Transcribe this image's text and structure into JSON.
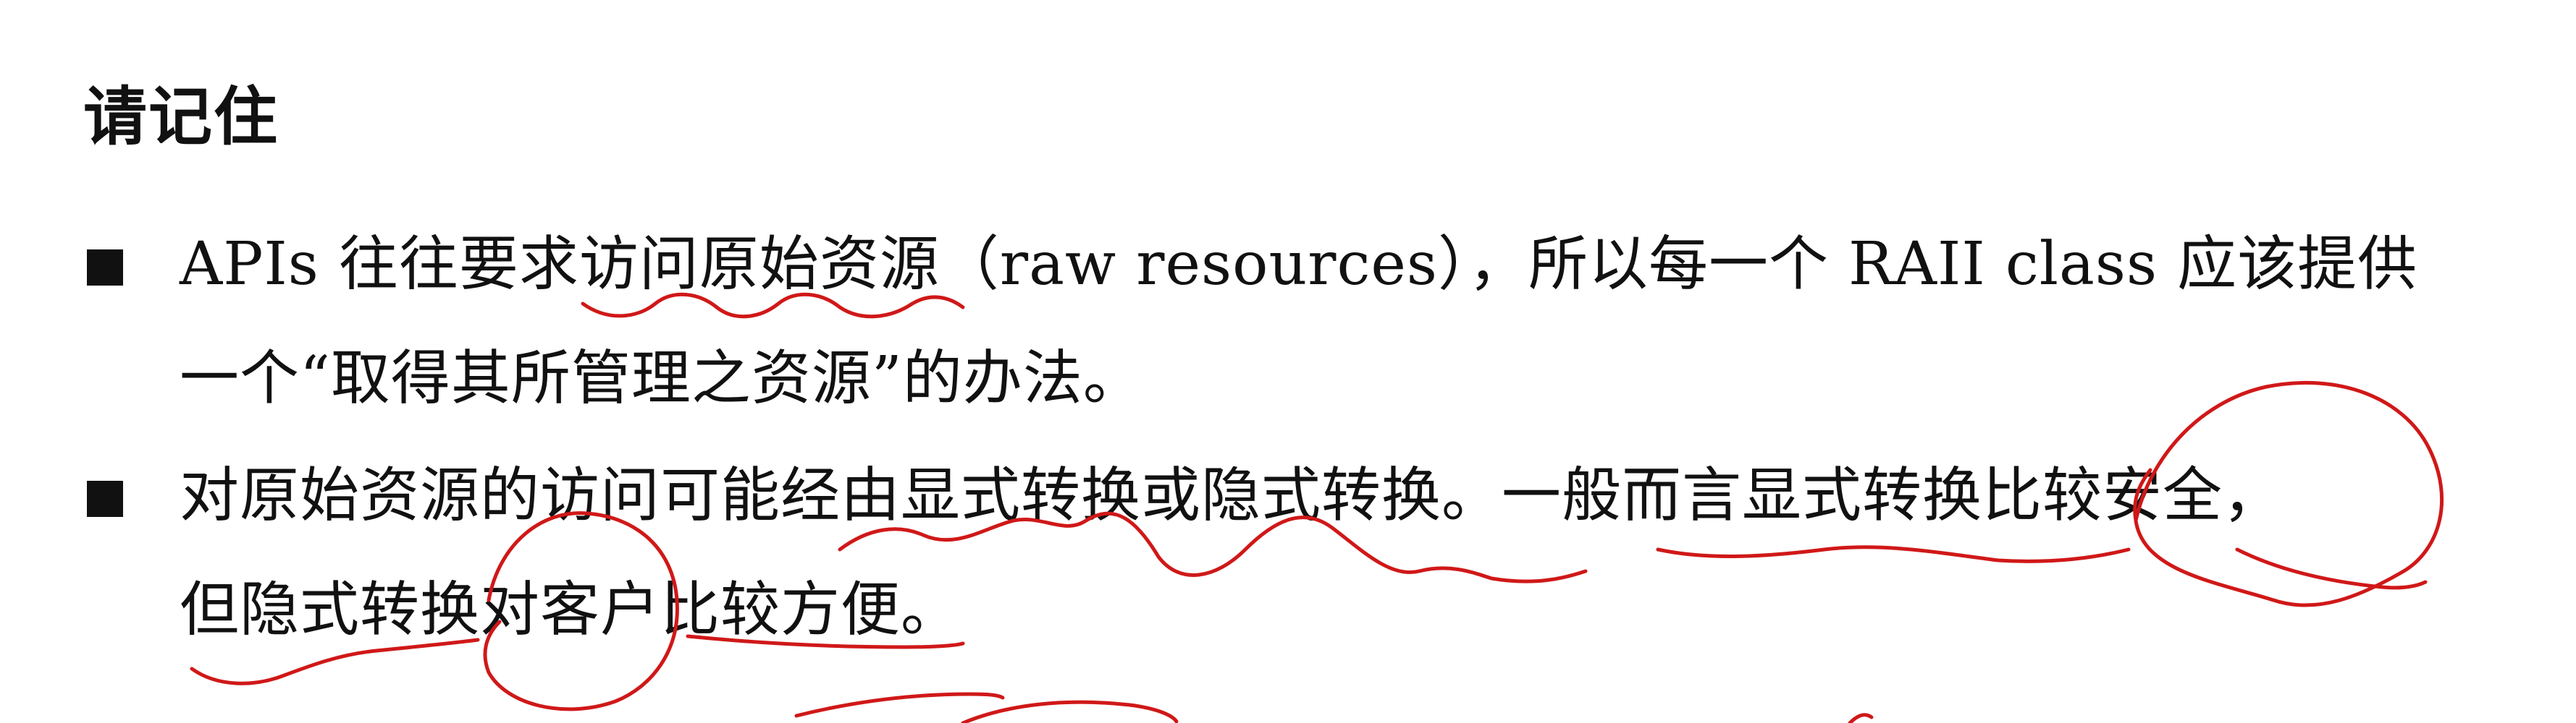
{
  "heading": "请记住",
  "bullets": [
    {
      "lines": [
        "APIs 往往要求访问原始资源（raw resources），所以每一个 RAII class 应该提供",
        "一个“取得其所管理之资源”的办法。"
      ]
    },
    {
      "lines": [
        "对原始资源的访问可能经由显式转换或隐式转换。一般而言显式转换比较安全，",
        "但隐式转换对客户比较方便。"
      ]
    }
  ],
  "annotation_color": "#d01818"
}
